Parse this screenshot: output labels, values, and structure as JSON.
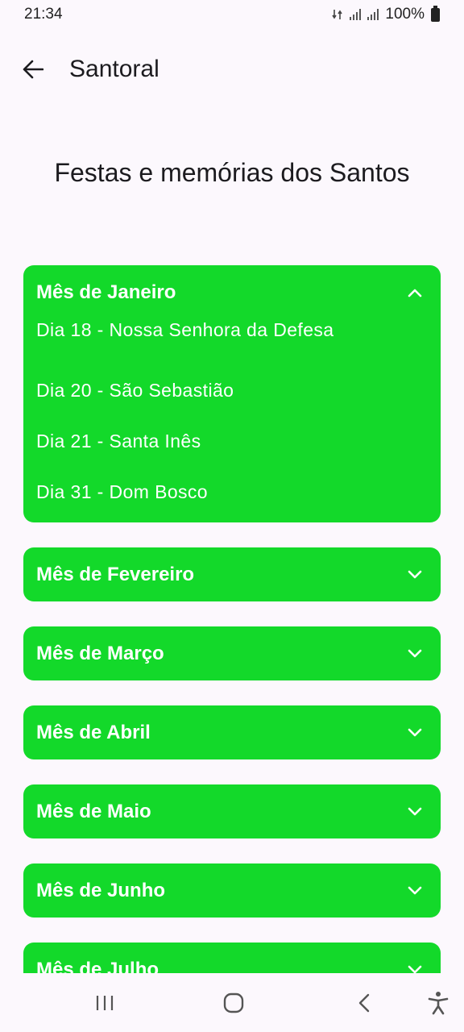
{
  "status": {
    "time": "21:34",
    "battery": "100%"
  },
  "app_bar": {
    "title": "Santoral"
  },
  "headline": "Festas e memórias dos Santos",
  "months": [
    {
      "title": "Mês de Janeiro",
      "expanded": true,
      "items": [
        "Dia 18 - Nossa Senhora da Defesa",
        "Dia 20 - São Sebastião",
        "Dia 21 - Santa Inês",
        "Dia 31 - Dom Bosco"
      ]
    },
    {
      "title": "Mês de Fevereiro",
      "expanded": false
    },
    {
      "title": "Mês de Março",
      "expanded": false
    },
    {
      "title": "Mês de Abril",
      "expanded": false
    },
    {
      "title": "Mês de Maio",
      "expanded": false
    },
    {
      "title": "Mês de Junho",
      "expanded": false
    },
    {
      "title": "Mês de Julho",
      "expanded": false
    }
  ],
  "colors": {
    "accent": "#13d92a",
    "background": "#fcf8fd",
    "text": "#1c1b1f"
  },
  "icons": {
    "back": "arrow-back-icon",
    "expand": "chevron-down-icon",
    "collapse": "chevron-up-icon",
    "nav_recents": "recents-icon",
    "nav_home": "home-icon",
    "nav_back": "back-icon",
    "nav_accessibility": "accessibility-icon"
  }
}
